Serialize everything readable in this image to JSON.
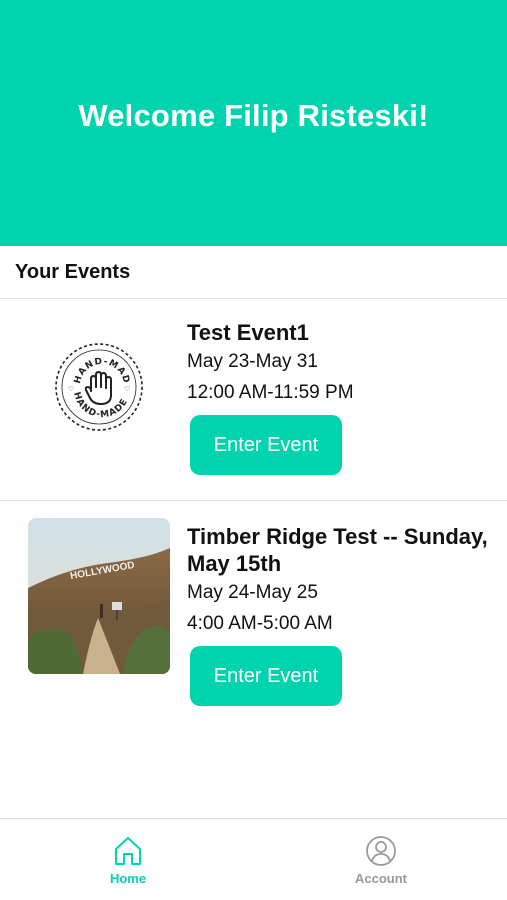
{
  "colors": {
    "accent": "#00d4ae",
    "inactive_tab": "#9a9a9a"
  },
  "header": {
    "welcome": "Welcome Filip Risteski!"
  },
  "events_section": {
    "title": "Your Events"
  },
  "events": [
    {
      "title": "Test Event1",
      "dates": "May 23-May 31",
      "time": "12:00 AM-11:59 PM",
      "button_label": "Enter Event",
      "thumbnail": "hand-made-stamp",
      "stamp_text": "HAND-MADE"
    },
    {
      "title": "Timber Ridge Test -- Sunday, May 15th",
      "dates": "May 24-May 25",
      "time": "4:00 AM-5:00 AM",
      "button_label": "Enter Event",
      "thumbnail": "hollywood-hills-photo",
      "photo_text": "HOLLYWOOD"
    }
  ],
  "tabbar": {
    "tabs": [
      {
        "label": "Home",
        "icon": "home-icon",
        "active": true
      },
      {
        "label": "Account",
        "icon": "account-icon",
        "active": false
      }
    ]
  }
}
